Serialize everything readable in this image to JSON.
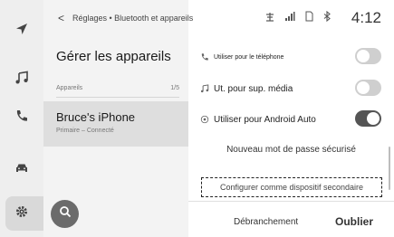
{
  "header": {
    "back_label": "<",
    "breadcrumb": "Réglages • Bluetooth et appareils",
    "status_icons": [
      "antenna-icon",
      "signal-icon",
      "sim-icon",
      "bluetooth-icon"
    ],
    "time": "4:12"
  },
  "rail": {
    "items": [
      {
        "icon": "navigation-icon"
      },
      {
        "icon": "music-icon"
      },
      {
        "icon": "phone-icon"
      },
      {
        "icon": "car-icon"
      },
      {
        "icon": "settings-icon",
        "active": true
      }
    ]
  },
  "devices": {
    "title": "Gérer les appareils",
    "list_label": "Appareils",
    "count": "1/5",
    "items": [
      {
        "name": "Bruce's iPhone",
        "status": "Primaire – Connecté",
        "selected": true
      }
    ],
    "search_icon": "search-icon"
  },
  "options": {
    "items": [
      {
        "icon": "phone-icon",
        "label": "Utiliser pour le téléphone",
        "enabled": false
      },
      {
        "icon": "music-icon",
        "label": "Ut. pour sup. média",
        "enabled": false
      },
      {
        "icon": "android-auto-icon",
        "label": "Utiliser pour Android Auto",
        "enabled": true
      }
    ],
    "secure_password": "Nouveau mot de passe sécurisé",
    "secondary_button": "Configurer comme dispositif secondaire",
    "disconnect": "Débranchement",
    "forget": "Oublier"
  },
  "colors": {
    "rail_bg": "#eeeeee",
    "panel_bg": "#f3f3f3",
    "selected_row": "#dedede",
    "toggle_on": "#555555",
    "toggle_off": "#cfcfcf"
  }
}
